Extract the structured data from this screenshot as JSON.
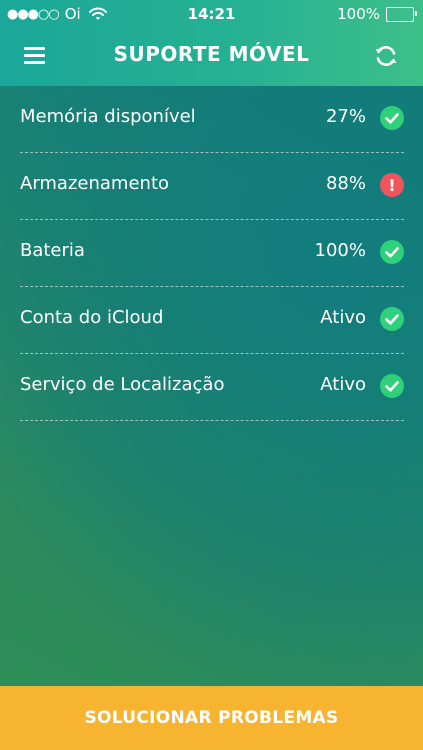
{
  "status_bar": {
    "signal": "●●●○○",
    "carrier": "Oi",
    "time": "14:21",
    "battery_percent": "100%"
  },
  "header": {
    "title": "SUPORTE MÓVEL"
  },
  "items": [
    {
      "label": "Memória disponível",
      "value": "27%",
      "status": "ok"
    },
    {
      "label": "Armazenamento",
      "value": "88%",
      "status": "error",
      "status_glyph": "!"
    },
    {
      "label": "Bateria",
      "value": "100%",
      "status": "ok"
    },
    {
      "label": "Conta do iCloud",
      "value": "Ativo",
      "status": "ok"
    },
    {
      "label": "Serviço de Localização",
      "value": "Ativo",
      "status": "ok"
    }
  ],
  "footer": {
    "action_label": "SOLUCIONAR PROBLEMAS"
  },
  "colors": {
    "header": "#25b193",
    "ok": "#2fd07a",
    "error": "#f0545c",
    "action": "#f7b430"
  }
}
